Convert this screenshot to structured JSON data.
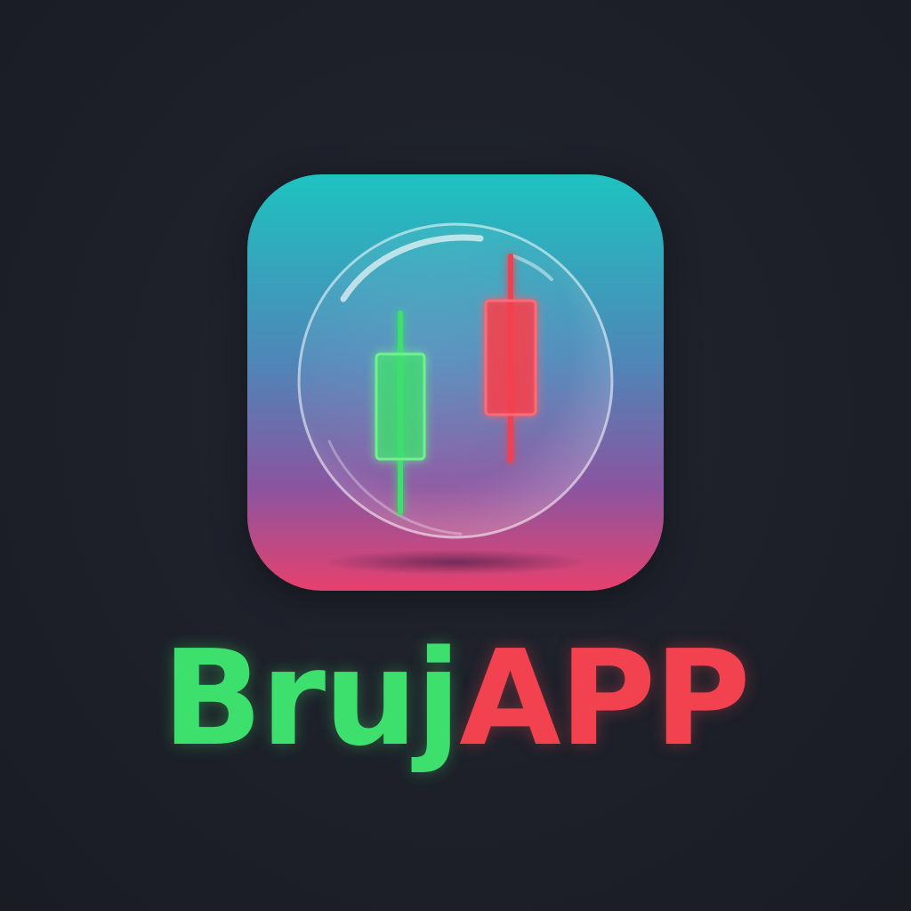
{
  "brand": {
    "name_part_1": "Bruj",
    "name_part_2": "APP",
    "name_part_1_color": "#3ee06d",
    "name_part_2_color": "#f2414f"
  },
  "icon": {
    "name": "candlestick-bubble-icon",
    "gradient_top": "#1ec3c0",
    "gradient_mid": "#4e86b8",
    "gradient_bottom": "#e6416e",
    "bullish_candle_color": "#3ee06d",
    "bearish_candle_color": "#f2414f"
  }
}
